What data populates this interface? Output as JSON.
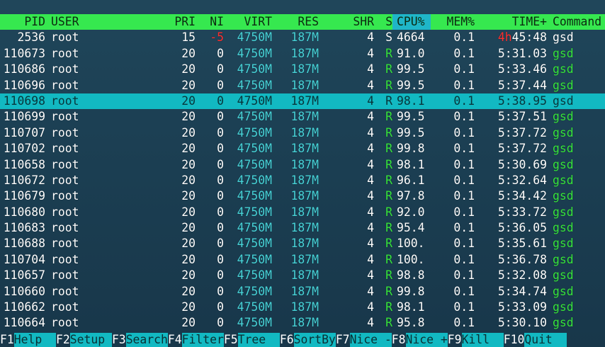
{
  "header": {
    "columns": [
      "PID",
      "USER",
      "PRI",
      "NI",
      "VIRT",
      "RES",
      "SHR",
      "S",
      "CPU%",
      "MEM%",
      "TIME+",
      "Command"
    ]
  },
  "colors": {
    "header_bg": "#36e84f",
    "sorted_col_bg": "#1fb6c8",
    "selected_row_bg": "#12b9c2",
    "memory_cyan": "#47d3d8",
    "running_green": "#37e33c",
    "highlight_red": "#ff3030"
  },
  "processes": [
    {
      "pid": "2536",
      "user": "root",
      "pri": "15",
      "ni": "-5",
      "virt": "4750M",
      "res": "187M",
      "shr": "4",
      "s": "S",
      "cpu": "4664",
      "mem": "0.1",
      "time_h": "4h",
      "time": "45:48",
      "cmd": "gsd"
    },
    {
      "pid": "110673",
      "user": "root",
      "pri": "20",
      "ni": "0",
      "virt": "4750M",
      "res": "187M",
      "shr": "4",
      "s": "R",
      "cpu": "91.0",
      "mem": "0.1",
      "time_h": "",
      "time": "5:31.03",
      "cmd": "gsd"
    },
    {
      "pid": "110686",
      "user": "root",
      "pri": "20",
      "ni": "0",
      "virt": "4750M",
      "res": "187M",
      "shr": "4",
      "s": "R",
      "cpu": "99.5",
      "mem": "0.1",
      "time_h": "",
      "time": "5:33.46",
      "cmd": "gsd"
    },
    {
      "pid": "110696",
      "user": "root",
      "pri": "20",
      "ni": "0",
      "virt": "4750M",
      "res": "187M",
      "shr": "4",
      "s": "R",
      "cpu": "99.5",
      "mem": "0.1",
      "time_h": "",
      "time": "5:37.44",
      "cmd": "gsd"
    },
    {
      "pid": "110698",
      "user": "root",
      "pri": "20",
      "ni": "0",
      "virt": "4750M",
      "res": "187M",
      "shr": "4",
      "s": "R",
      "cpu": "98.1",
      "mem": "0.1",
      "time_h": "",
      "time": "5:38.95",
      "cmd": "gsd"
    },
    {
      "pid": "110699",
      "user": "root",
      "pri": "20",
      "ni": "0",
      "virt": "4750M",
      "res": "187M",
      "shr": "4",
      "s": "R",
      "cpu": "99.5",
      "mem": "0.1",
      "time_h": "",
      "time": "5:37.51",
      "cmd": "gsd"
    },
    {
      "pid": "110707",
      "user": "root",
      "pri": "20",
      "ni": "0",
      "virt": "4750M",
      "res": "187M",
      "shr": "4",
      "s": "R",
      "cpu": "99.5",
      "mem": "0.1",
      "time_h": "",
      "time": "5:37.72",
      "cmd": "gsd"
    },
    {
      "pid": "110702",
      "user": "root",
      "pri": "20",
      "ni": "0",
      "virt": "4750M",
      "res": "187M",
      "shr": "4",
      "s": "R",
      "cpu": "99.8",
      "mem": "0.1",
      "time_h": "",
      "time": "5:37.72",
      "cmd": "gsd"
    },
    {
      "pid": "110658",
      "user": "root",
      "pri": "20",
      "ni": "0",
      "virt": "4750M",
      "res": "187M",
      "shr": "4",
      "s": "R",
      "cpu": "98.1",
      "mem": "0.1",
      "time_h": "",
      "time": "5:30.69",
      "cmd": "gsd"
    },
    {
      "pid": "110672",
      "user": "root",
      "pri": "20",
      "ni": "0",
      "virt": "4750M",
      "res": "187M",
      "shr": "4",
      "s": "R",
      "cpu": "96.1",
      "mem": "0.1",
      "time_h": "",
      "time": "5:32.64",
      "cmd": "gsd"
    },
    {
      "pid": "110679",
      "user": "root",
      "pri": "20",
      "ni": "0",
      "virt": "4750M",
      "res": "187M",
      "shr": "4",
      "s": "R",
      "cpu": "97.8",
      "mem": "0.1",
      "time_h": "",
      "time": "5:34.42",
      "cmd": "gsd"
    },
    {
      "pid": "110680",
      "user": "root",
      "pri": "20",
      "ni": "0",
      "virt": "4750M",
      "res": "187M",
      "shr": "4",
      "s": "R",
      "cpu": "92.0",
      "mem": "0.1",
      "time_h": "",
      "time": "5:33.72",
      "cmd": "gsd"
    },
    {
      "pid": "110683",
      "user": "root",
      "pri": "20",
      "ni": "0",
      "virt": "4750M",
      "res": "187M",
      "shr": "4",
      "s": "R",
      "cpu": "95.4",
      "mem": "0.1",
      "time_h": "",
      "time": "5:36.05",
      "cmd": "gsd"
    },
    {
      "pid": "110688",
      "user": "root",
      "pri": "20",
      "ni": "0",
      "virt": "4750M",
      "res": "187M",
      "shr": "4",
      "s": "R",
      "cpu": "100.",
      "mem": "0.1",
      "time_h": "",
      "time": "5:35.61",
      "cmd": "gsd"
    },
    {
      "pid": "110704",
      "user": "root",
      "pri": "20",
      "ni": "0",
      "virt": "4750M",
      "res": "187M",
      "shr": "4",
      "s": "R",
      "cpu": "100.",
      "mem": "0.1",
      "time_h": "",
      "time": "5:36.78",
      "cmd": "gsd"
    },
    {
      "pid": "110657",
      "user": "root",
      "pri": "20",
      "ni": "0",
      "virt": "4750M",
      "res": "187M",
      "shr": "4",
      "s": "R",
      "cpu": "98.8",
      "mem": "0.1",
      "time_h": "",
      "time": "5:32.08",
      "cmd": "gsd"
    },
    {
      "pid": "110660",
      "user": "root",
      "pri": "20",
      "ni": "0",
      "virt": "4750M",
      "res": "187M",
      "shr": "4",
      "s": "R",
      "cpu": "99.8",
      "mem": "0.1",
      "time_h": "",
      "time": "5:34.74",
      "cmd": "gsd"
    },
    {
      "pid": "110662",
      "user": "root",
      "pri": "20",
      "ni": "0",
      "virt": "4750M",
      "res": "187M",
      "shr": "4",
      "s": "R",
      "cpu": "98.1",
      "mem": "0.1",
      "time_h": "",
      "time": "5:33.09",
      "cmd": "gsd"
    },
    {
      "pid": "110664",
      "user": "root",
      "pri": "20",
      "ni": "0",
      "virt": "4750M",
      "res": "187M",
      "shr": "4",
      "s": "R",
      "cpu": "95.8",
      "mem": "0.1",
      "time_h": "",
      "time": "5:30.10",
      "cmd": "gsd"
    }
  ],
  "selected_index": 4,
  "footer": [
    {
      "key": "F1",
      "label": "Help  "
    },
    {
      "key": "F2",
      "label": "Setup "
    },
    {
      "key": "F3",
      "label": "Search"
    },
    {
      "key": "F4",
      "label": "Filter"
    },
    {
      "key": "F5",
      "label": "Tree  "
    },
    {
      "key": "F6",
      "label": "SortBy"
    },
    {
      "key": "F7",
      "label": "Nice -"
    },
    {
      "key": "F8",
      "label": "Nice +"
    },
    {
      "key": "F9",
      "label": "Kill  "
    },
    {
      "key": "F10",
      "label": "Quit  "
    }
  ]
}
